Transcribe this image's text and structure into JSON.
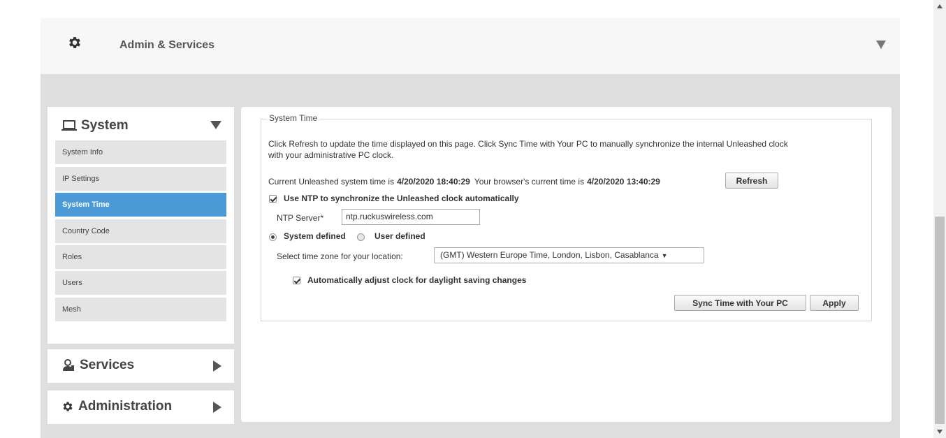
{
  "header": {
    "title": "Admin & Services",
    "icon": "gear-icon"
  },
  "sidebar": {
    "system": {
      "title": "System",
      "icon": "laptop-icon",
      "items": [
        {
          "label": "System Info",
          "active": false
        },
        {
          "label": "IP Settings",
          "active": false
        },
        {
          "label": "System Time",
          "active": true
        },
        {
          "label": "Country Code",
          "active": false
        },
        {
          "label": "Roles",
          "active": false
        },
        {
          "label": "Users",
          "active": false
        },
        {
          "label": "Mesh",
          "active": false
        }
      ]
    },
    "services": {
      "title": "Services",
      "icon": "services-icon"
    },
    "administration": {
      "title": "Administration",
      "icon": "gear-icon"
    }
  },
  "system_time": {
    "legend": "System Time",
    "description_line1": "Click Refresh to update the time displayed on this page. Click Sync Time with Your PC to manually synchronize the internal Unleashed clock",
    "description_line2": "with your administrative PC clock.",
    "current_prefix": "Current Unleashed system time is",
    "current_system_time": "4/20/2020 18:40:29",
    "browser_prefix": "Your browser's current time is",
    "browser_time": "4/20/2020 13:40:29",
    "refresh_label": "Refresh",
    "ntp_checkbox_label": "Use NTP to synchronize the Unleashed clock automatically",
    "ntp_enabled": true,
    "ntp_server_label": "NTP Server*",
    "ntp_server_value": "ntp.ruckuswireless.com",
    "system_defined_label": "System defined",
    "user_defined_label": "User defined",
    "selected_mode": "System defined",
    "timezone_label": "Select time zone for your location:",
    "timezone_value": "(GMT) Western Europe Time, London, Lisbon, Casablanca",
    "dst_label": "Automatically adjust clock for daylight saving changes",
    "dst_enabled": true,
    "sync_label": "Sync Time with Your PC",
    "apply_label": "Apply"
  },
  "colors": {
    "active_menu": "#4a9ad8",
    "panel_bg": "#dedede"
  }
}
